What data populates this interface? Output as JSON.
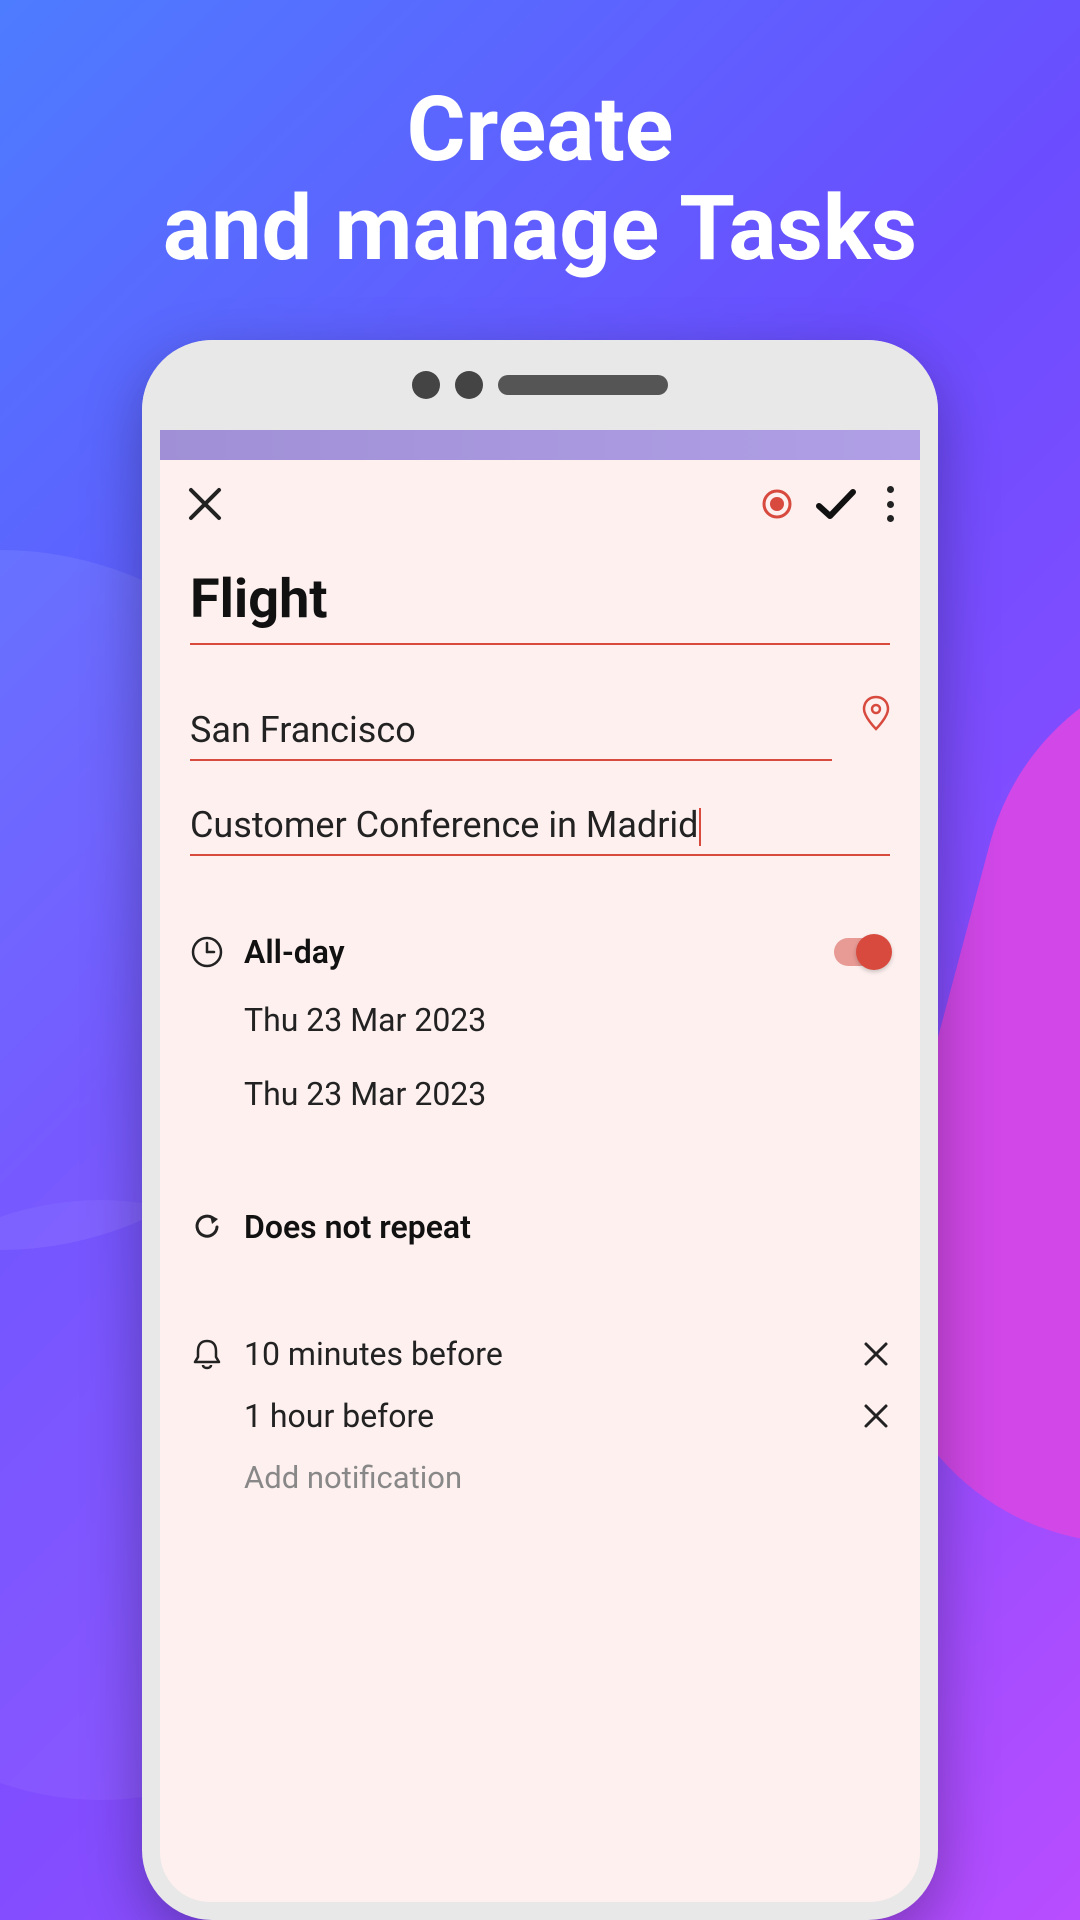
{
  "marketing": {
    "headline_line1": "Create",
    "headline_line2": "and manage Tasks"
  },
  "toolbar": {
    "close": "close",
    "record": "record",
    "confirm": "confirm",
    "more": "more"
  },
  "task": {
    "title": "Flight",
    "location": "San Francisco",
    "description": "Customer Conference in Madrid"
  },
  "schedule": {
    "all_day_label": "All-day",
    "all_day_on": true,
    "start_date": "Thu 23 Mar 2023",
    "end_date": "Thu 23 Mar 2023"
  },
  "repeat": {
    "label": "Does not repeat"
  },
  "notifications": {
    "items": [
      "10 minutes before",
      "1 hour before"
    ],
    "add_label": "Add notification"
  },
  "colors": {
    "accent": "#d84a3e"
  }
}
